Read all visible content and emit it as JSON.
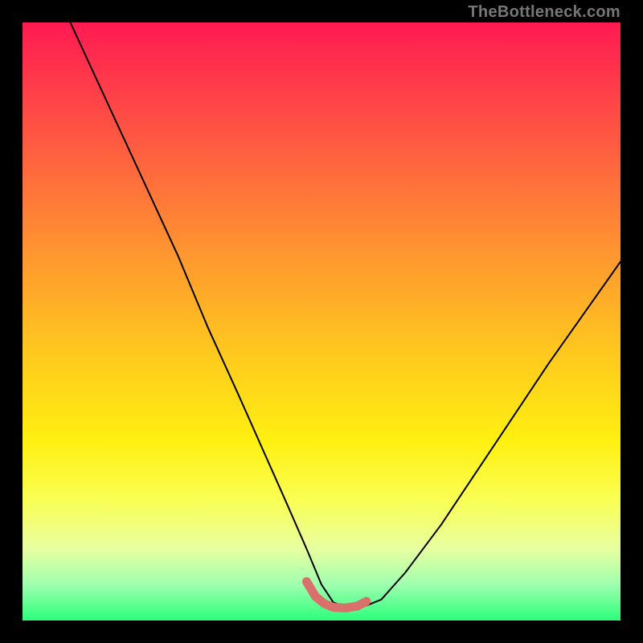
{
  "watermark": "TheBottleneck.com",
  "chart_data": {
    "type": "line",
    "title": "",
    "xlabel": "",
    "ylabel": "",
    "xlim": [
      0,
      100
    ],
    "ylim": [
      0,
      100
    ],
    "series": [
      {
        "name": "bottleneck-curve",
        "color": "#000000",
        "stroke_width": 2,
        "x": [
          8,
          14,
          20,
          26,
          31,
          36,
          40,
          44,
          47.5,
          50,
          52,
          55,
          57.5,
          60,
          64,
          70,
          78,
          88,
          100
        ],
        "values": [
          100,
          87,
          74,
          61,
          49,
          38,
          29,
          20,
          12,
          6,
          3,
          2,
          2.5,
          3.5,
          8,
          16,
          28,
          43,
          60
        ]
      },
      {
        "name": "optimal-band",
        "color": "#d9706b",
        "stroke_width": 11,
        "x": [
          47.5,
          49,
          50.5,
          52,
          54,
          56,
          57.5
        ],
        "values": [
          6.5,
          4,
          2.8,
          2.2,
          2.1,
          2.4,
          3.2
        ]
      }
    ],
    "background_gradient": {
      "direction": "top-to-bottom",
      "stops": [
        {
          "pos": 0.0,
          "color": "#ff1a52"
        },
        {
          "pos": 0.25,
          "color": "#ff6a3d"
        },
        {
          "pos": 0.55,
          "color": "#ffc81f"
        },
        {
          "pos": 0.8,
          "color": "#f9ff55"
        },
        {
          "pos": 1.0,
          "color": "#2bff7a"
        }
      ]
    }
  }
}
